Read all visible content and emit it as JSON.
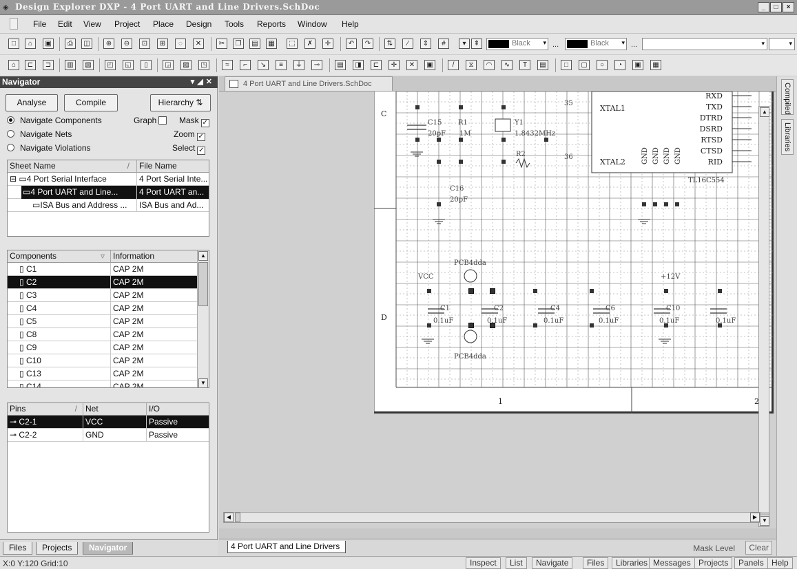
{
  "window": {
    "title": "Design Explorer DXP - 4 Port UART and Line Drivers.SchDoc",
    "controls": [
      "_",
      "□",
      "×"
    ]
  },
  "menu": [
    "File",
    "Edit",
    "View",
    "Project",
    "Place",
    "Design",
    "Tools",
    "Reports",
    "Window",
    "Help"
  ],
  "toolbar": {
    "color1": "Black",
    "color2": "Black",
    "dots": "..."
  },
  "navigator": {
    "title": "Navigator",
    "buttons": {
      "analyse": "Analyse",
      "compile": "Compile",
      "hierarchy": "Hierarchy"
    },
    "options": [
      "Navigate Components",
      "Navigate Nets",
      "Navigate Violations"
    ],
    "checks": [
      "Graph",
      "Mask",
      "Zoom",
      "Select"
    ],
    "sheets": {
      "headers": [
        "Sheet Name",
        "File Name"
      ],
      "rows": [
        [
          "4 Port Serial Interface",
          "4 Port Serial Inte..."
        ],
        [
          "4 Port UART and Line...",
          "4 Port UART an..."
        ],
        [
          "ISA Bus and Address ...",
          "ISA Bus and Ad..."
        ]
      ]
    },
    "components": {
      "headers": [
        "Components",
        "Information"
      ],
      "rows": [
        [
          "C1",
          "CAP 2M"
        ],
        [
          "C2",
          "CAP 2M"
        ],
        [
          "C3",
          "CAP 2M"
        ],
        [
          "C4",
          "CAP 2M"
        ],
        [
          "C5",
          "CAP 2M"
        ],
        [
          "C8",
          "CAP 2M"
        ],
        [
          "C9",
          "CAP 2M"
        ],
        [
          "C10",
          "CAP 2M"
        ],
        [
          "C13",
          "CAP 2M"
        ],
        [
          "C14",
          "CAP 2M"
        ]
      ]
    },
    "pins": {
      "headers": [
        "Pins",
        "Net",
        "I/O"
      ],
      "rows": [
        [
          "C2-1",
          "VCC",
          "Passive"
        ],
        [
          "C2-2",
          "GND",
          "Passive"
        ]
      ]
    },
    "tabs": [
      "Files",
      "Projects",
      "Navigator"
    ]
  },
  "document": {
    "tab": "4 Port UART and Line Drivers.SchDoc",
    "sheet_tab": "4 Port UART and Line Drivers",
    "mask_level": "Mask Level",
    "clear": "Clear",
    "zones": {
      "c": "C",
      "d": "D",
      "one": "1",
      "two": "2"
    },
    "schematic": {
      "xtal1": "XTAL1",
      "xtal2": "XTAL2",
      "chip": "TL16C554",
      "pins": [
        "RXD",
        "TXD",
        "DTRD",
        "DSRD",
        "RTSD",
        "CTSD",
        "RID"
      ],
      "gnd": "GND",
      "vcc": "VCC",
      "v12": "+12V",
      "c15": "C15",
      "c15v": "20pF",
      "c16": "C16",
      "c16v": "20pF",
      "r1": "R1",
      "r1v": "1M",
      "y1": "Y1",
      "y1v": "1.8432MHz",
      "r2": "R2",
      "pcb": "PCB4dda",
      "pcb2": "PCB4dda",
      "caps": [
        "C1",
        "C2",
        "C4",
        "C6",
        "C10"
      ],
      "capv": [
        "0.1uF",
        "0.1uF",
        "0.1uF",
        "0.1uF",
        "0.1uF",
        "0.1uF"
      ],
      "p35": "35",
      "p36": "36"
    }
  },
  "side_tabs": [
    "Compiled",
    "Libraries"
  ],
  "status": {
    "coords": "X:0 Y:120   Grid:10",
    "buttons": [
      "Inspect",
      "List",
      "Navigate",
      "Files",
      "Libraries",
      "Messages",
      "Projects",
      "Panels",
      "Help"
    ]
  }
}
